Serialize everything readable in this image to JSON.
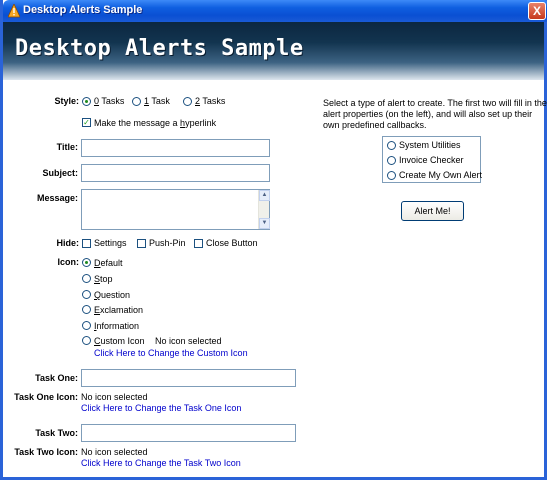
{
  "window": {
    "title": "Desktop Alerts Sample",
    "close": "X"
  },
  "banner": {
    "text": "Desktop Alerts Sample"
  },
  "style": {
    "label": "Style:",
    "options": [
      "0 Tasks",
      "1 Task",
      "2 Tasks"
    ],
    "selected": "0 Tasks",
    "hyperlink_label": "Make the message a hyperlink",
    "hyperlink_checked": true
  },
  "title_field": {
    "label": "Title:",
    "value": ""
  },
  "subject_field": {
    "label": "Subject:",
    "value": ""
  },
  "message_field": {
    "label": "Message:",
    "value": ""
  },
  "hide": {
    "label": "Hide:",
    "options": [
      "Settings",
      "Push-Pin",
      "Close Button"
    ]
  },
  "icon": {
    "label": "Icon:",
    "options": [
      "Default",
      "Stop",
      "Question",
      "Exclamation",
      "Information",
      "Custom Icon"
    ],
    "selected": "Default",
    "custom_status": "No icon selected",
    "custom_link": "Click Here to Change the Custom Icon"
  },
  "task_one": {
    "label": "Task One:",
    "value": "",
    "icon_label": "Task One Icon:",
    "icon_status": "No icon selected",
    "icon_link": "Click Here to Change the Task One Icon"
  },
  "task_two": {
    "label": "Task Two:",
    "value": "",
    "icon_label": "Task Two Icon:",
    "icon_status": "No icon selected",
    "icon_link": "Click Here to Change the Task Two Icon"
  },
  "right_panel": {
    "description_1": "Select a type of alert to create. The first two will fill in the",
    "description_2": "alert properties (on the left),  and will also set up their",
    "description_3": "own predefined callbacks.",
    "alert_types": [
      "System Utilities",
      "Invoice Checker",
      "Create My Own Alert"
    ],
    "button": "Alert Me!"
  }
}
